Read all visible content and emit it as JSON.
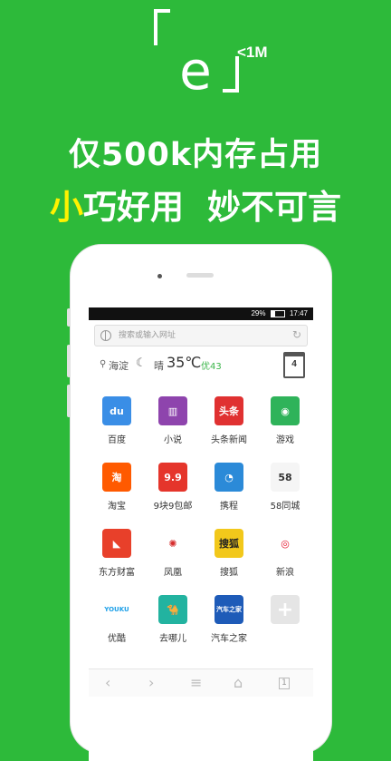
{
  "promo": {
    "logo_letter": "e",
    "logo_sup": "<1M",
    "headline1": "仅500k内存占用",
    "headline2_highlight": "小",
    "headline2_rest": "巧好用",
    "headline2_second": "妙不可言"
  },
  "status_bar": {
    "battery": "29%",
    "time": "17:47"
  },
  "search": {
    "placeholder": "搜索或输入网址"
  },
  "weather": {
    "location": "海淀",
    "condition": "晴",
    "temperature": "35℃",
    "aqi": "优43",
    "calendar_day": "4"
  },
  "apps": [
    {
      "label": "百度",
      "icon": "baidu-icon",
      "glyph": "du",
      "color": "#3a8ee6"
    },
    {
      "label": "小说",
      "icon": "book-icon",
      "glyph": "▥",
      "color": "#8e44ad"
    },
    {
      "label": "头条新闻",
      "icon": "toutiao-icon",
      "glyph": "头条",
      "color": "#e03131"
    },
    {
      "label": "游戏",
      "icon": "gamepad-icon",
      "glyph": "◉",
      "color": "#2fb35a"
    },
    {
      "label": "淘宝",
      "icon": "taobao-icon",
      "glyph": "淘",
      "color": "#ff5a00"
    },
    {
      "label": "9块9包邮",
      "icon": "nine-nine-icon",
      "glyph": "9.9",
      "color": "#e5352b"
    },
    {
      "label": "携程",
      "icon": "ctrip-icon",
      "glyph": "◔",
      "color": "#2b8ad8"
    },
    {
      "label": "58同城",
      "icon": "58-icon",
      "glyph": "58",
      "color": "#f5f5f5"
    },
    {
      "label": "东方财富",
      "icon": "eastmoney-icon",
      "glyph": "◣",
      "color": "#e8402a"
    },
    {
      "label": "凤凰",
      "icon": "phoenix-icon",
      "glyph": "✺",
      "color": "#ffffff"
    },
    {
      "label": "搜狐",
      "icon": "sohu-icon",
      "glyph": "搜狐",
      "color": "#f2c81b"
    },
    {
      "label": "新浪",
      "icon": "weibo-icon",
      "glyph": "◎",
      "color": "#ffffff"
    },
    {
      "label": "优酷",
      "icon": "youku-icon",
      "glyph": "YOUKU",
      "color": "#ffffff"
    },
    {
      "label": "去哪儿",
      "icon": "qunar-icon",
      "glyph": "🐪",
      "color": "#22b3a0"
    },
    {
      "label": "汽车之家",
      "icon": "autohome-icon",
      "glyph": "汽车之家",
      "color": "#1e5bb8"
    },
    {
      "label": "",
      "icon": "add-icon",
      "glyph": "+",
      "color": "#e5e5e5"
    }
  ],
  "toolbar": {
    "back": "‹",
    "forward": "›",
    "menu": "≡",
    "home": "⌂",
    "tabs": "1"
  }
}
